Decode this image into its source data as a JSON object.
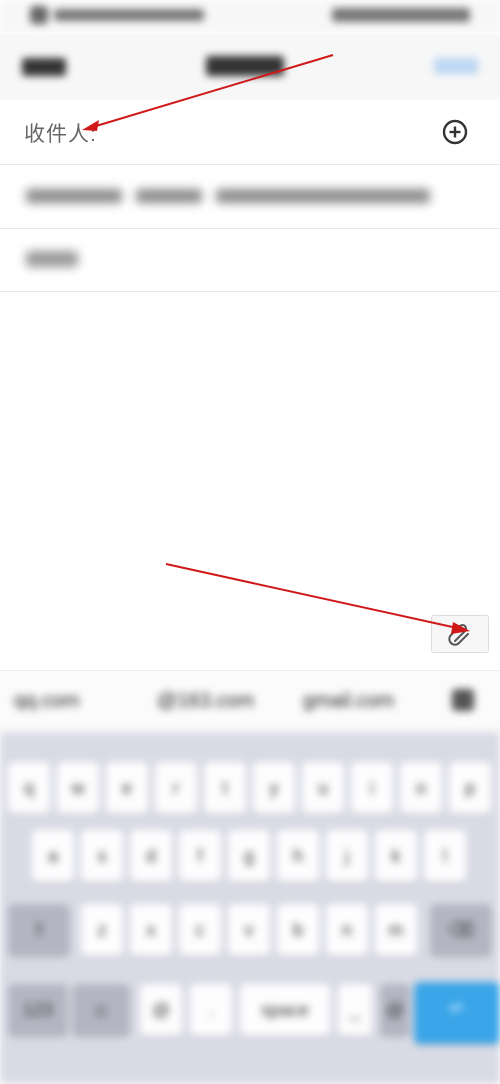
{
  "to_field": {
    "label": "收件人:"
  },
  "icons": {
    "add": "plus-circle-icon",
    "attach": "paperclip-icon"
  },
  "suggestions": [
    "qq.com",
    "@163.com",
    "gmail.com"
  ],
  "keyboard_rows": [
    [
      "q",
      "w",
      "e",
      "r",
      "t",
      "y",
      "u",
      "i",
      "o",
      "p"
    ],
    [
      "a",
      "s",
      "d",
      "f",
      "g",
      "h",
      "j",
      "k",
      "l"
    ],
    [
      "⇧",
      "z",
      "x",
      "c",
      "v",
      "b",
      "n",
      "m",
      "⌫"
    ],
    [
      "123",
      "☺",
      "@",
      ".",
      "space",
      "_",
      "@",
      "↵"
    ]
  ],
  "colors": {
    "annotation_arrow": "#d01818",
    "keyboard_bg": "#d9dae4",
    "enter_key": "#3aa5e8"
  }
}
